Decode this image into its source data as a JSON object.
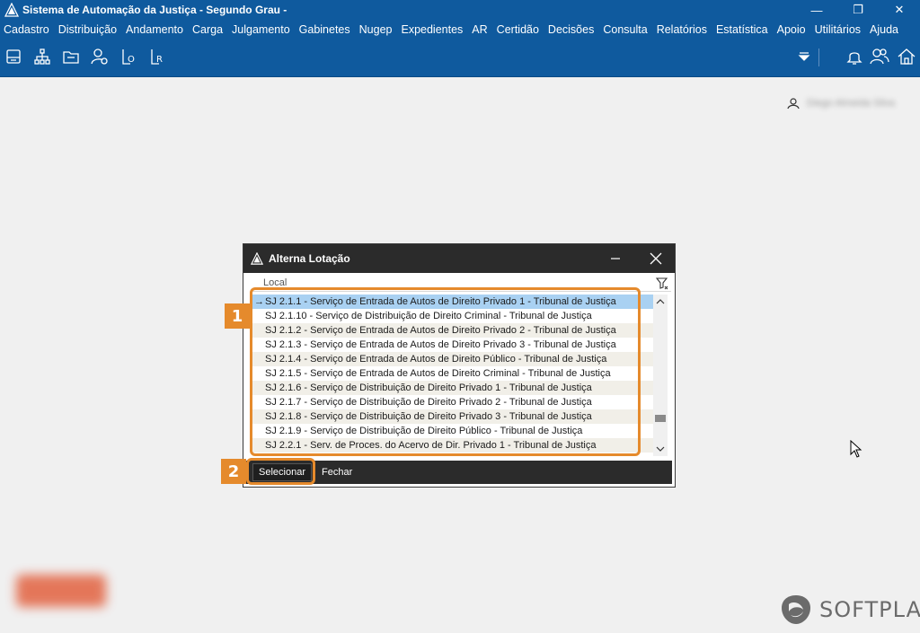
{
  "window": {
    "title": "Sistema de Automação da Justiça - Segundo Grau -",
    "minimize_glyph": "—",
    "restore_glyph": "❐",
    "close_glyph": "✕"
  },
  "menu": [
    "Cadastro",
    "Distribuição",
    "Andamento",
    "Carga",
    "Julgamento",
    "Gabinetes",
    "Nugep",
    "Expedientes",
    "AR",
    "Certidão",
    "Decisões",
    "Consulta",
    "Relatórios",
    "Estatística",
    "Apoio",
    "Utilitários",
    "Ajuda"
  ],
  "toolbar": {
    "icons": [
      "printer-icon",
      "org-chart-icon",
      "folder-icon",
      "user-settings-icon",
      "lo-icon",
      "lr-icon",
      "dropdown-arrow-icon",
      "bell-icon",
      "users-icon",
      "home-icon"
    ],
    "lo_letter": "O",
    "lr_letter": "R"
  },
  "user": {
    "name": "Diego Almeida Silva"
  },
  "dialog": {
    "title": "Alterna Lotação",
    "column_header": "Local",
    "rows": [
      "SJ 2.1.1 - Serviço de Entrada de Autos de Direito Privado 1 - Tribunal de Justiça",
      "SJ 2.1.10 - Serviço de Distribuição de Direito Criminal - Tribunal de Justiça",
      "SJ 2.1.2 - Serviço de Entrada de Autos de Direito Privado 2 - Tribunal de Justiça",
      "SJ 2.1.3 - Serviço de Entrada de Autos de Direito Privado 3 - Tribunal de Justiça",
      "SJ 2.1.4 - Serviço de Entrada de Autos de Direito Público - Tribunal de Justiça",
      "SJ 2.1.5 - Serviço de Entrada de Autos de Direito Criminal - Tribunal de Justiça",
      "SJ 2.1.6 - Serviço de Distribuição de Direito Privado 1 - Tribunal de Justiça",
      "SJ 2.1.7 - Serviço de Distribuição de Direito Privado 2 - Tribunal de Justiça",
      "SJ 2.1.8 - Serviço de Distribuição de Direito Privado 3 - Tribunal de Justiça",
      "SJ 2.1.9 - Serviço de Distribuição de Direito Público - Tribunal de Justiça",
      "SJ 2.2.1 - Serv. de Proces. do Acervo de Dir. Privado 1 - Tribunal de Justiça"
    ],
    "selected_index": 0,
    "row_pointer": "→",
    "select_button": "Selecionar",
    "close_button": "Fechar"
  },
  "annotations": {
    "badge_1": "1",
    "badge_2": "2",
    "color": "#e58a2c"
  },
  "brand": {
    "name": "SOFTPLAN"
  },
  "colors": {
    "primary": "#0f5a9e",
    "selection": "#a9d1f2",
    "dialog_dark": "#2b2b2b"
  }
}
